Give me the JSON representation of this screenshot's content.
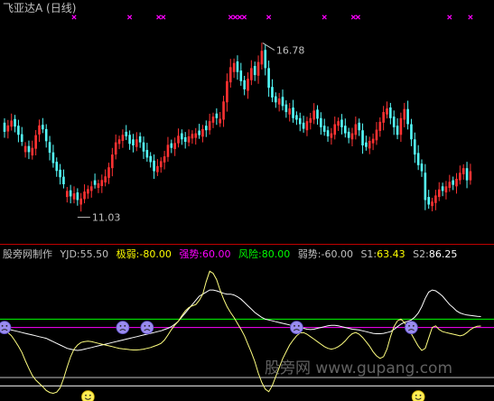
{
  "title": "飞亚达A (日线)",
  "watermark": "股旁网 www.gupang.com",
  "colors": {
    "background": "#000000",
    "up": "#ff3232",
    "down": "#54fcfc",
    "marker": "#ff00ff",
    "text": "#c0c0c0",
    "divider": "#c00000",
    "yjd": "#ffffff",
    "weak_line": "#ffffff",
    "strong_line": "#ff00ff",
    "risk_line": "#00ff00",
    "weak_trend": "#c0c0c0",
    "s1": "#ffff00",
    "s2": "#ffffff",
    "label_weak": "#ffff00",
    "label_strong": "#ff00ff",
    "label_risk": "#00ff00",
    "smiley": "#ffee55",
    "sad": "#9a8cf0"
  },
  "chart_data": [
    {
      "type": "candlestick",
      "title": "飞亚达A (日线)",
      "annotations": [
        {
          "text": "16.78",
          "value": 16.78,
          "index": 74
        },
        {
          "text": "11.03",
          "value": 11.03,
          "index": 21
        }
      ],
      "ylim": [
        10.75,
        17.6
      ],
      "marker_groups": [
        {
          "center": 20,
          "count": 1
        },
        {
          "center": 36,
          "count": 1
        },
        {
          "center": 45,
          "count": 2
        },
        {
          "center": 67,
          "count": 4
        },
        {
          "center": 76,
          "count": 1
        },
        {
          "center": 92,
          "count": 1
        },
        {
          "center": 101,
          "count": 2
        },
        {
          "center": 128,
          "count": 1
        },
        {
          "center": 134,
          "count": 1
        }
      ],
      "closes": [
        13.85,
        14.06,
        14.22,
        14.02,
        13.75,
        13.52,
        13.38,
        13.18,
        13.32,
        13.74,
        14.06,
        13.93,
        13.54,
        13.16,
        12.82,
        12.56,
        12.35,
        12.12,
        11.9,
        11.72,
        11.82,
        11.6,
        11.65,
        11.88,
        11.96,
        12.05,
        12.1,
        12.15,
        12.26,
        12.38,
        12.68,
        13.1,
        13.5,
        13.6,
        13.75,
        13.7,
        13.45,
        13.4,
        13.6,
        13.5,
        13.2,
        13.0,
        12.85,
        12.55,
        12.72,
        12.88,
        13.04,
        13.42,
        13.32,
        13.48,
        13.72,
        13.6,
        13.52,
        13.7,
        13.78,
        13.8,
        13.74,
        13.94,
        13.9,
        14.2,
        14.35,
        14.3,
        14.28,
        14.85,
        15.52,
        15.98,
        16.12,
        15.82,
        15.52,
        15.25,
        15.6,
        15.95,
        15.72,
        16.15,
        16.52,
        15.95,
        15.3,
        14.98,
        14.82,
        14.95,
        14.7,
        14.5,
        14.62,
        14.3,
        14.25,
        14.1,
        13.95,
        14.2,
        14.3,
        14.55,
        14.28,
        14.0,
        13.85,
        13.7,
        13.8,
        14.1,
        14.2,
        14.0,
        13.8,
        13.65,
        13.8,
        14.1,
        13.9,
        13.4,
        13.35,
        13.55,
        13.62,
        13.92,
        14.18,
        14.5,
        14.62,
        14.3,
        14.0,
        13.75,
        14.3,
        14.6,
        14.1,
        13.6,
        13.1,
        12.75,
        12.55,
        11.6,
        11.45,
        11.55,
        11.75,
        11.95,
        11.9,
        12.05,
        12.2,
        12.1,
        12.3,
        12.5,
        12.65,
        12.25,
        12.55
      ],
      "moves": [
        -0.3,
        0.2,
        0.2,
        -0.25,
        -0.3,
        -0.25,
        0.2,
        -0.2,
        0.25,
        0.45,
        0.3,
        -0.15,
        -0.4,
        -0.35,
        -0.35,
        -0.3,
        -0.25,
        -0.25,
        0.2,
        -0.2,
        0.2,
        -0.25,
        0.2,
        0.25,
        0.15,
        0.15,
        -0.15,
        0.15,
        0.2,
        0.2,
        0.35,
        0.45,
        0.4,
        0.15,
        0.2,
        -0.15,
        -0.3,
        -0.2,
        0.25,
        -0.2,
        -0.3,
        -0.25,
        -0.2,
        -0.35,
        0.2,
        0.2,
        0.2,
        0.4,
        -0.15,
        0.2,
        0.25,
        -0.2,
        -0.15,
        0.2,
        0.15,
        0.15,
        -0.15,
        0.25,
        -0.15,
        0.3,
        0.2,
        -0.15,
        0.15,
        0.6,
        0.7,
        0.5,
        0.3,
        -0.35,
        -0.35,
        -0.3,
        0.4,
        0.4,
        -0.3,
        0.45,
        0.45,
        -0.6,
        -0.65,
        -0.35,
        -0.2,
        0.2,
        -0.3,
        -0.25,
        0.2,
        -0.35,
        -0.15,
        -0.2,
        -0.2,
        0.3,
        0.15,
        0.3,
        -0.3,
        -0.3,
        -0.2,
        -0.2,
        0.15,
        0.35,
        0.15,
        -0.25,
        -0.25,
        -0.2,
        0.2,
        0.35,
        -0.25,
        -0.5,
        -0.15,
        0.25,
        0.15,
        0.35,
        0.3,
        0.35,
        0.2,
        -0.35,
        -0.35,
        -0.3,
        0.55,
        0.35,
        -0.5,
        -0.5,
        -0.5,
        -0.4,
        -0.25,
        -0.9,
        -0.25,
        0.15,
        0.25,
        0.25,
        -0.15,
        0.2,
        0.2,
        -0.15,
        0.25,
        0.25,
        0.2,
        -0.4,
        0.3
      ]
    },
    {
      "type": "line",
      "title": "股旁网制作",
      "values_line": {
        "YJD": {
          "label": "YJD:",
          "value": "55.50"
        },
        "weak": {
          "label": "极弱:",
          "value": "-80.00"
        },
        "strong": {
          "label": "强势:",
          "value": "60.00"
        },
        "risk": {
          "label": "风险:",
          "value": "80.00"
        },
        "weak_trend": {
          "label": "弱势:",
          "value": "-60.00"
        },
        "S1": {
          "label": "S1:",
          "value": "63.43"
        },
        "S2": {
          "label": "S2:",
          "value": "86.25"
        }
      },
      "ylim": [
        -112,
        200
      ],
      "levels": [
        {
          "name": "risk",
          "value": 80
        },
        {
          "name": "strong",
          "value": 60
        },
        {
          "name": "weak_trend",
          "value": -60
        },
        {
          "name": "weak",
          "value": -80
        }
      ],
      "S1_values": [
        52,
        48,
        40,
        28,
        15,
        0,
        -20,
        -38,
        -55,
        -66,
        -74,
        -82,
        -91,
        -96,
        -98,
        -95,
        -85,
        -62,
        -35,
        -10,
        8,
        18,
        24,
        26,
        27,
        26,
        24,
        22,
        20,
        18,
        16,
        14,
        12,
        10,
        9,
        8,
        7,
        6,
        6,
        7,
        8,
        10,
        12,
        15,
        18,
        22,
        30,
        42,
        55,
        66,
        75,
        88,
        100,
        108,
        112,
        115,
        125,
        140,
        170,
        195,
        190,
        175,
        150,
        128,
        110,
        96,
        84,
        70,
        56,
        40,
        20,
        0,
        -22,
        -50,
        -72,
        -88,
        -94,
        -80,
        -58,
        -36,
        -15,
        2,
        18,
        30,
        40,
        47,
        48,
        44,
        38,
        32,
        26,
        20,
        14,
        10,
        8,
        10,
        14,
        20,
        28,
        38,
        45,
        48,
        44,
        36,
        26,
        15,
        2,
        -8,
        -14,
        -10,
        8,
        38,
        62,
        76,
        80,
        72,
        60,
        45,
        30,
        15,
        5,
        10,
        35,
        60,
        64,
        55,
        50,
        48,
        46,
        44,
        42,
        40,
        42,
        48,
        55,
        60,
        63,
        63.43
      ],
      "S2_values": [
        56,
        55,
        54,
        52,
        50,
        48,
        46,
        44,
        42,
        40,
        38,
        36,
        34,
        30,
        26,
        22,
        18,
        14,
        10,
        8,
        6,
        5,
        6,
        8,
        10,
        12,
        14,
        16,
        18,
        20,
        22,
        24,
        26,
        28,
        30,
        32,
        34,
        36,
        38,
        40,
        42,
        44,
        46,
        48,
        50,
        52,
        55,
        58,
        62,
        68,
        75,
        85,
        95,
        105,
        115,
        125,
        135,
        140,
        145,
        150,
        150,
        148,
        145,
        142,
        140,
        140,
        138,
        134,
        128,
        120,
        112,
        104,
        96,
        90,
        84,
        80,
        78,
        76,
        74,
        72,
        70,
        68,
        66,
        64,
        62,
        60,
        58,
        56,
        55,
        56,
        58,
        60,
        62,
        64,
        65,
        65,
        64,
        62,
        60,
        58,
        56,
        55,
        54,
        52,
        50,
        48,
        46,
        45,
        45,
        46,
        48,
        50,
        55,
        62,
        68,
        72,
        75,
        78,
        85,
        95,
        110,
        130,
        145,
        150,
        148,
        142,
        135,
        125,
        115,
        108,
        100,
        95,
        92,
        90,
        89,
        88,
        87,
        86.25
      ],
      "smiley_indices": [
        24,
        119
      ],
      "sad_indices": [
        0,
        34,
        41,
        84,
        117
      ]
    }
  ]
}
